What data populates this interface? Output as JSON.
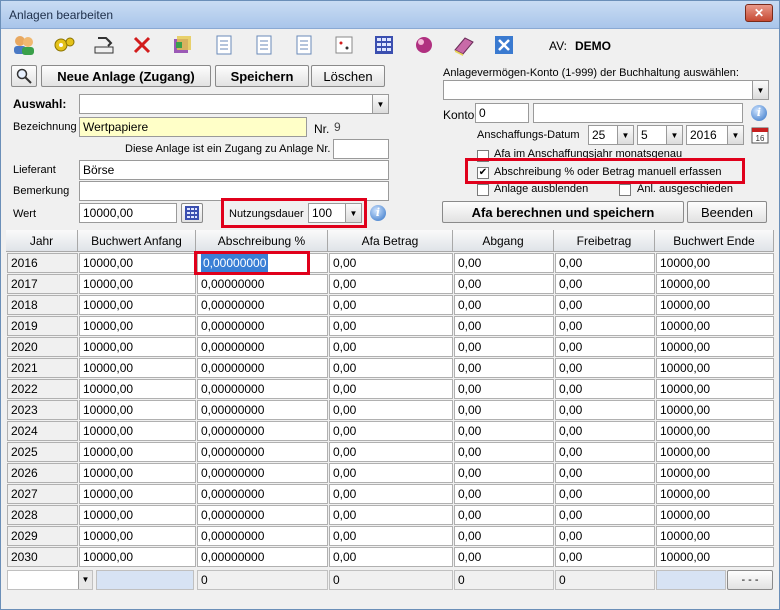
{
  "window": {
    "title": "Anlagen bearbeiten",
    "close_glyph": "✕"
  },
  "toolbar": {
    "icons": [
      "users-icon",
      "gear-icon",
      "export-icon",
      "delete-icon",
      "cube-icon",
      "document-icon",
      "document-icon",
      "document-icon",
      "dice-icon",
      "calculator-icon",
      "ball-icon",
      "book-icon",
      "close-box-icon"
    ],
    "av_label": "AV:",
    "av_value": "DEMO"
  },
  "actions": {
    "new_label": "Neue Anlage (Zugang)",
    "save_label": "Speichern",
    "delete_label": "Löschen",
    "calc_label": "Afa berechnen und speichern",
    "close_label": "Beenden"
  },
  "form": {
    "auswahl_label": "Auswahl:",
    "auswahl_value": "",
    "bezeichnung_label": "Bezeichnung",
    "bezeichnung_value": "Wertpapiere",
    "nr_label": "Nr.",
    "nr_value": "9",
    "zugang_label": "Diese Anlage ist ein Zugang zu Anlage Nr.",
    "zugang_value": "",
    "lieferant_label": "Lieferant",
    "lieferant_value": "Börse",
    "bemerkung_label": "Bemerkung",
    "bemerkung_value": "",
    "wert_label": "Wert",
    "wert_value": "10000,00",
    "nutzungsdauer_label": "Nutzungsdauer",
    "nutzungsdauer_value": "100"
  },
  "right": {
    "konto_select_label": "Anlagevermögen-Konto (1-999) der Buchhaltung auswählen:",
    "konto_select_value": "",
    "konto_label": "Konto",
    "konto_value": "0",
    "konto_name": "",
    "date_label": "Anschaffungs-Datum",
    "day": "25",
    "month": "5",
    "year": "2016",
    "chk1_label": "Afa im Anschaffungsjahr monatsgenau",
    "chk2_label": "Abschreibung % oder Betrag manuell erfassen",
    "chk3_label": "Anlage ausblenden",
    "chk4_label": "Anl. ausgeschieden"
  },
  "table": {
    "headers": [
      "Jahr",
      "Buchwert Anfang",
      "Abschreibung %",
      "Afa Betrag",
      "Abgang",
      "Freibetrag",
      "Buchwert Ende"
    ],
    "rows": [
      [
        "2016",
        "10000,00",
        "0,00000000",
        "0,00",
        "0,00",
        "0,00",
        "10000,00"
      ],
      [
        "2017",
        "10000,00",
        "0,00000000",
        "0,00",
        "0,00",
        "0,00",
        "10000,00"
      ],
      [
        "2018",
        "10000,00",
        "0,00000000",
        "0,00",
        "0,00",
        "0,00",
        "10000,00"
      ],
      [
        "2019",
        "10000,00",
        "0,00000000",
        "0,00",
        "0,00",
        "0,00",
        "10000,00"
      ],
      [
        "2020",
        "10000,00",
        "0,00000000",
        "0,00",
        "0,00",
        "0,00",
        "10000,00"
      ],
      [
        "2021",
        "10000,00",
        "0,00000000",
        "0,00",
        "0,00",
        "0,00",
        "10000,00"
      ],
      [
        "2022",
        "10000,00",
        "0,00000000",
        "0,00",
        "0,00",
        "0,00",
        "10000,00"
      ],
      [
        "2023",
        "10000,00",
        "0,00000000",
        "0,00",
        "0,00",
        "0,00",
        "10000,00"
      ],
      [
        "2024",
        "10000,00",
        "0,00000000",
        "0,00",
        "0,00",
        "0,00",
        "10000,00"
      ],
      [
        "2025",
        "10000,00",
        "0,00000000",
        "0,00",
        "0,00",
        "0,00",
        "10000,00"
      ],
      [
        "2026",
        "10000,00",
        "0,00000000",
        "0,00",
        "0,00",
        "0,00",
        "10000,00"
      ],
      [
        "2027",
        "10000,00",
        "0,00000000",
        "0,00",
        "0,00",
        "0,00",
        "10000,00"
      ],
      [
        "2028",
        "10000,00",
        "0,00000000",
        "0,00",
        "0,00",
        "0,00",
        "10000,00"
      ],
      [
        "2029",
        "10000,00",
        "0,00000000",
        "0,00",
        "0,00",
        "0,00",
        "10000,00"
      ],
      [
        "2030",
        "10000,00",
        "0,00000000",
        "0,00",
        "0,00",
        "0,00",
        "10000,00"
      ]
    ],
    "footer": [
      "0",
      "0",
      "0",
      "0"
    ],
    "footer_button": "- - -"
  },
  "colors": {
    "highlight": "#e0001b",
    "selection": "#3a7fd5",
    "bezeichnung_bg": "#ffffc8"
  }
}
